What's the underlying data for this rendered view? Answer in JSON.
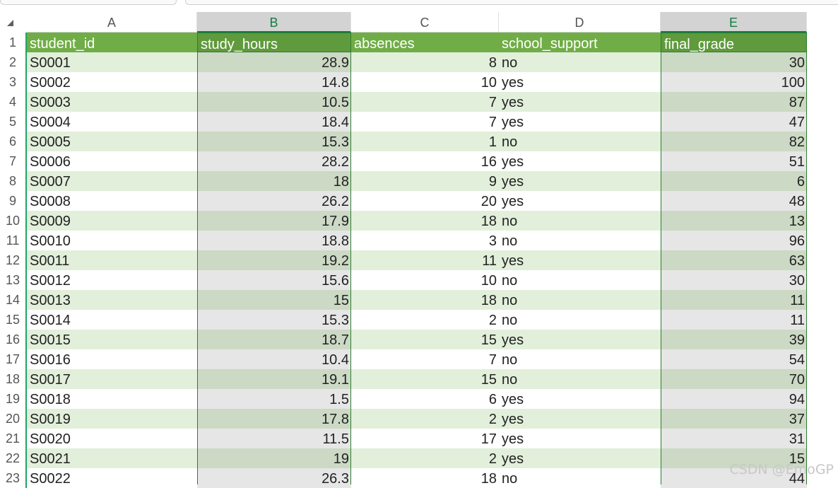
{
  "columns": [
    {
      "letter": "A",
      "header": "student_id"
    },
    {
      "letter": "B",
      "header": "study_hours"
    },
    {
      "letter": "C",
      "header": "absences"
    },
    {
      "letter": "D",
      "header": "school_support"
    },
    {
      "letter": "E",
      "header": "final_grade"
    }
  ],
  "selected_columns": [
    "B",
    "E"
  ],
  "row_numbers": [
    "1",
    "2",
    "3",
    "4",
    "5",
    "6",
    "7",
    "8",
    "9",
    "10",
    "11",
    "12",
    "13",
    "14",
    "15",
    "16",
    "17",
    "18",
    "19",
    "20",
    "21",
    "22",
    "23"
  ],
  "rows": [
    [
      "S0001",
      "28.9",
      "8",
      "no",
      "30"
    ],
    [
      "S0002",
      "14.8",
      "10",
      "yes",
      "100"
    ],
    [
      "S0003",
      "10.5",
      "7",
      "yes",
      "87"
    ],
    [
      "S0004",
      "18.4",
      "7",
      "yes",
      "47"
    ],
    [
      "S0005",
      "15.3",
      "1",
      "no",
      "82"
    ],
    [
      "S0006",
      "28.2",
      "16",
      "yes",
      "51"
    ],
    [
      "S0007",
      "18",
      "9",
      "yes",
      "6"
    ],
    [
      "S0008",
      "26.2",
      "20",
      "yes",
      "48"
    ],
    [
      "S0009",
      "17.9",
      "18",
      "no",
      "13"
    ],
    [
      "S0010",
      "18.8",
      "3",
      "no",
      "96"
    ],
    [
      "S0011",
      "19.2",
      "11",
      "yes",
      "63"
    ],
    [
      "S0012",
      "15.6",
      "10",
      "no",
      "30"
    ],
    [
      "S0013",
      "15",
      "18",
      "no",
      "11"
    ],
    [
      "S0014",
      "15.3",
      "2",
      "no",
      "11"
    ],
    [
      "S0015",
      "18.7",
      "15",
      "yes",
      "39"
    ],
    [
      "S0016",
      "10.4",
      "7",
      "no",
      "54"
    ],
    [
      "S0017",
      "19.1",
      "15",
      "no",
      "70"
    ],
    [
      "S0018",
      "1.5",
      "6",
      "yes",
      "94"
    ],
    [
      "S0019",
      "17.8",
      "2",
      "yes",
      "37"
    ],
    [
      "S0020",
      "11.5",
      "17",
      "yes",
      "31"
    ],
    [
      "S0021",
      "19",
      "2",
      "yes",
      "15"
    ],
    [
      "S0022",
      "26.3",
      "18",
      "no",
      "44"
    ]
  ],
  "colors": {
    "header_fill": "#70ad47",
    "band_fill": "#e2efda",
    "selection_accent": "#107c41"
  },
  "icons": {
    "select_all": "select-all-triangle-icon"
  },
  "watermark": "CSDN @EmoGP"
}
